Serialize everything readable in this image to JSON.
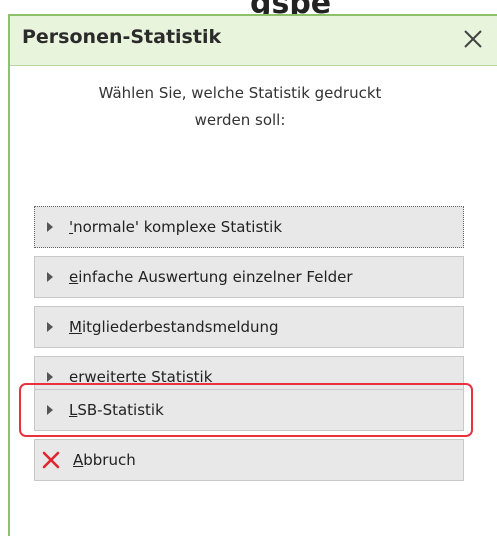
{
  "background_text": "gspe",
  "dialog": {
    "title": "Personen-Statistik",
    "prompt": "Wählen Sie, welche Statistik gedruckt\nwerden soll:"
  },
  "options": [
    {
      "accel": "'",
      "rest": "normale' komplexe Statistik"
    },
    {
      "accel": "e",
      "rest": "infache Auswertung einzelner Felder"
    },
    {
      "accel": "M",
      "rest": "itgliederbestandsmeldung"
    },
    {
      "accel": "e",
      "rest": "rweiterte Statistik"
    },
    {
      "accel": "L",
      "rest": "SB-Statistik"
    }
  ],
  "cancel": {
    "accel": "A",
    "rest": "bbruch",
    "icon": "close-x-icon",
    "icon_color": "#e0262f"
  },
  "colors": {
    "titlebar": "#e8f5dc",
    "border": "#8cc36a",
    "highlight": "#e8323f",
    "button": "#e8e8e8"
  }
}
